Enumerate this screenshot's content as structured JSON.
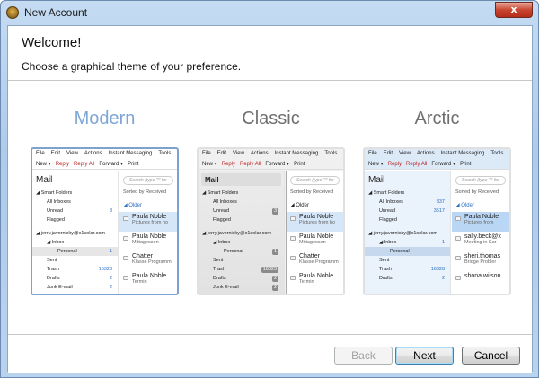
{
  "window": {
    "title": "New Account",
    "close_label": "x"
  },
  "header": {
    "welcome": "Welcome!",
    "subtitle": "Choose a graphical theme of your preference."
  },
  "footer": {
    "back": "Back",
    "next": "Next",
    "cancel": "Cancel"
  },
  "preview_common": {
    "menu": [
      "File",
      "Edit",
      "View",
      "Actions",
      "Instant Messaging",
      "Tools"
    ],
    "toolbar": [
      "New ▾",
      "Reply",
      "Reply All",
      "Forward ▾",
      "Print"
    ],
    "mail_title": "Mail",
    "search_placeholder": "Search (type '?' for",
    "sorted": "Sorted by Received",
    "older": "Older"
  },
  "themes": [
    {
      "key": "modern",
      "name": "Modern",
      "color": "#7ea6d6",
      "selected": true,
      "folders": [
        [
          "Smart Folders",
          "",
          0
        ],
        [
          "All Inboxes",
          "",
          1
        ],
        [
          "Unread",
          "3",
          1
        ],
        [
          "Flagged",
          "",
          1
        ],
        [
          "",
          ""
        ],
        [
          "jerry.javornicky@x1solar.com",
          "",
          0
        ],
        [
          "Inbox",
          "",
          1
        ],
        [
          "Personal",
          "1",
          2,
          true
        ],
        [
          "Sent",
          "",
          1
        ],
        [
          "Trash",
          "16323",
          1
        ],
        [
          "Drafts",
          "2",
          1
        ],
        [
          "Junk E-mail",
          "2",
          1
        ]
      ],
      "messages": [
        [
          "Paula Noble",
          "Pictures from ho",
          true
        ],
        [
          "Paula Noble",
          "Mittagessen"
        ],
        [
          "Chatter",
          "Klasse Programm"
        ],
        [
          "Paula Noble",
          "Termin"
        ]
      ]
    },
    {
      "key": "classic",
      "name": "Classic",
      "color": "#707070",
      "selected": false,
      "folders": [
        [
          "Smart Folders",
          "",
          0
        ],
        [
          "All Inboxes",
          "",
          1
        ],
        [
          "Unread",
          "3",
          1
        ],
        [
          "Flagged",
          "",
          1
        ],
        [
          "",
          ""
        ],
        [
          "jerry.javornicky@x1solar.com",
          "",
          0
        ],
        [
          "Inbox",
          "",
          1
        ],
        [
          "Personal",
          "1",
          2,
          true
        ],
        [
          "Sent",
          "",
          1
        ],
        [
          "Trash",
          "16323",
          1
        ],
        [
          "Drafts",
          "2",
          1
        ],
        [
          "Junk E-mail",
          "2",
          1
        ]
      ],
      "messages": [
        [
          "Paula Noble",
          "Pictures from ho",
          true
        ],
        [
          "Paula Noble",
          "Mittagessen"
        ],
        [
          "Chatter",
          "Klasse Programm"
        ],
        [
          "Paula Noble",
          "Termin"
        ]
      ]
    },
    {
      "key": "arctic",
      "name": "Arctic",
      "color": "#707070",
      "selected": false,
      "folders": [
        [
          "Smart Folders",
          "",
          0
        ],
        [
          "All Inboxes",
          "337",
          1
        ],
        [
          "Unread",
          "3517",
          1
        ],
        [
          "Flagged",
          "",
          1
        ],
        [
          "",
          ""
        ],
        [
          "jerry.javornicky@x1solar.com",
          "",
          0
        ],
        [
          "Inbox",
          "1",
          1
        ],
        [
          "Personal",
          "",
          2,
          true
        ],
        [
          "Sent",
          "",
          1
        ],
        [
          "Trash",
          "16328",
          1
        ],
        [
          "Drafts",
          "2",
          1
        ]
      ],
      "messages": [
        [
          "Paula Noble",
          "Pictures from",
          true
        ],
        [
          "sally.beck@x",
          "Meeting in Sar"
        ],
        [
          "sheri.thomas",
          "Bridge Probler"
        ],
        [
          "shona.wilson",
          ""
        ]
      ]
    }
  ]
}
